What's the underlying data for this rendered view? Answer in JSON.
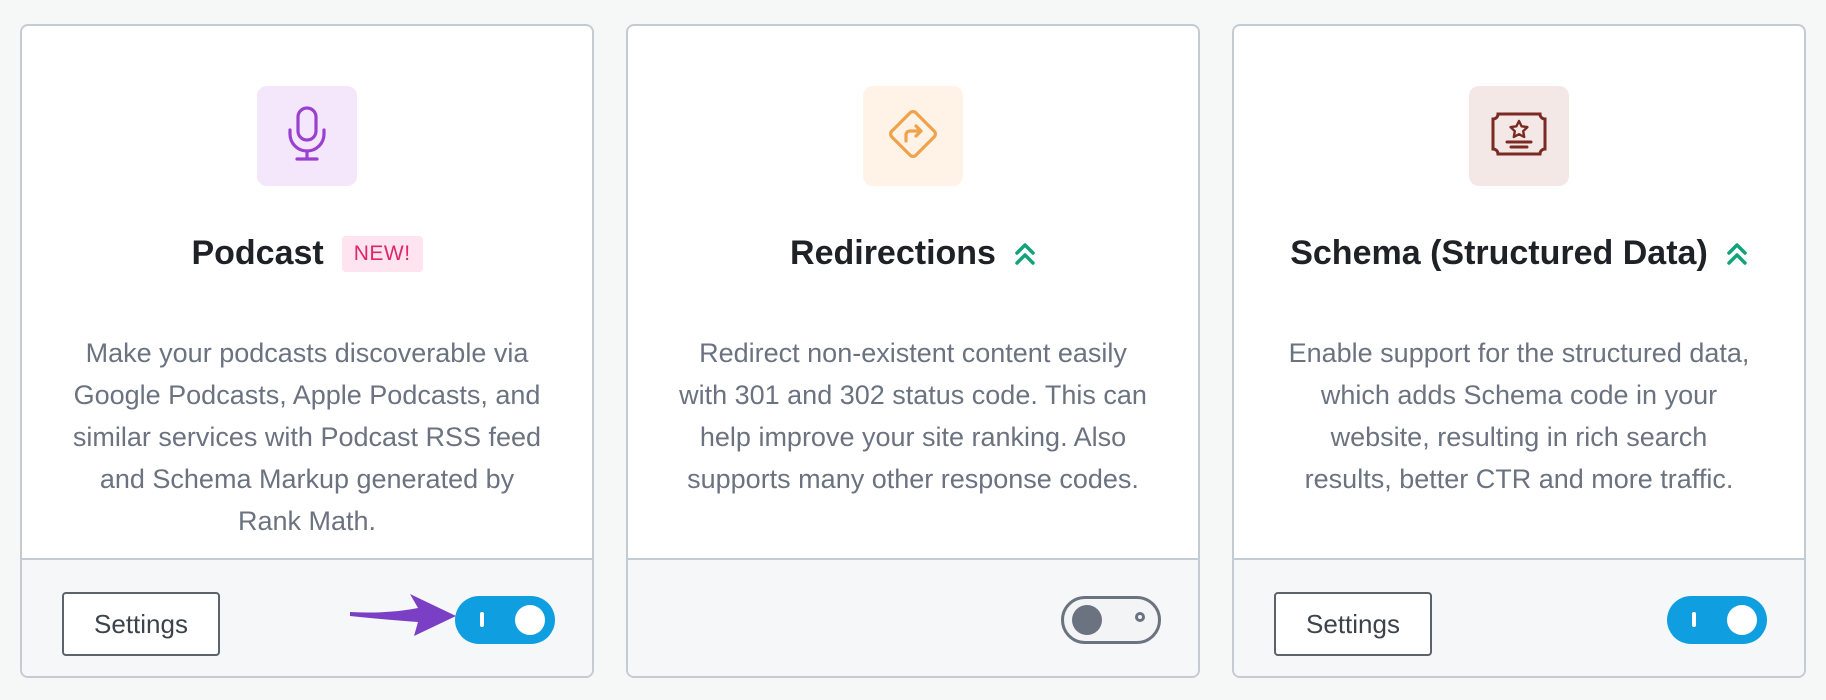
{
  "modules": [
    {
      "title": "Podcast",
      "badge": "NEW!",
      "icon": "microphone-icon",
      "description": "Make your podcasts discoverable via Google Podcasts, Apple Podcasts, and similar services with Podcast RSS feed and Schema Markup generated by Rank Math.",
      "settings_label": "Settings",
      "enabled": true
    },
    {
      "title": "Redirections",
      "icon": "redirect-sign-icon",
      "description": "Redirect non-existent content easily with 301 and 302 status code. This can help improve your site ranking. Also supports many other response codes.",
      "enabled": false
    },
    {
      "title": "Schema (Structured Data)",
      "icon": "certificate-icon",
      "description": "Enable support for the structured data, which adds Schema code in your website, resulting in rich search results, better CTR and more traffic.",
      "settings_label": "Settings",
      "enabled": true
    }
  ],
  "colors": {
    "toggle_on": "#0f9fe0",
    "toggle_off": "#6b7380",
    "badge_bg": "#fde4ee",
    "badge_text": "#e0256b",
    "pro_chevron": "#12a37b",
    "annotation_arrow": "#7b3fc6"
  }
}
